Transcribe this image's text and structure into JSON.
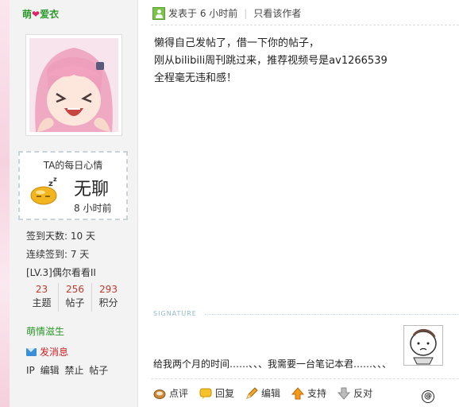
{
  "sidebar": {
    "username_left": "萌",
    "username_right": "爱衣",
    "mood": {
      "title": "TA的每日心情",
      "text": "无聊",
      "time": "8 小时前"
    },
    "stats": {
      "sign_days": "签到天数: 10 天",
      "streak": "连续签到: 7 天",
      "level": "[LV.3]偶尔看看II"
    },
    "counts": [
      {
        "num": "23",
        "label": "主题"
      },
      {
        "num": "256",
        "label": "帖子"
      },
      {
        "num": "293",
        "label": "积分"
      }
    ],
    "medal": "萌情滋生",
    "send_message": "发消息",
    "admin_links": [
      "IP",
      "编辑",
      "禁止",
      "帖子"
    ]
  },
  "post": {
    "posted_time": "发表于 6 小时前",
    "only_author": "只看该作者",
    "body": [
      "懒得自己发帖了，借一下你的帖子，",
      "刚从bilibili周刊跳过来，推荐视频号是av1266539",
      "全程毫无违和感！"
    ],
    "signature_label": "SIGNATURE",
    "signature_text": "给我两个月的时间……、、、我需要一台笔记本君……、、、"
  },
  "actions": [
    {
      "label": "点评",
      "icon": "comment-icon"
    },
    {
      "label": "回复",
      "icon": "reply-icon"
    },
    {
      "label": "编辑",
      "icon": "edit-pencil-icon"
    },
    {
      "label": "支持",
      "icon": "support-arrow-up-icon"
    },
    {
      "label": "反对",
      "icon": "oppose-arrow-down-icon"
    }
  ],
  "colors": {
    "username": "#2a9a2a",
    "count_num": "#c0392b",
    "send_msg": "#cc2222",
    "heart": "#e0206a"
  }
}
